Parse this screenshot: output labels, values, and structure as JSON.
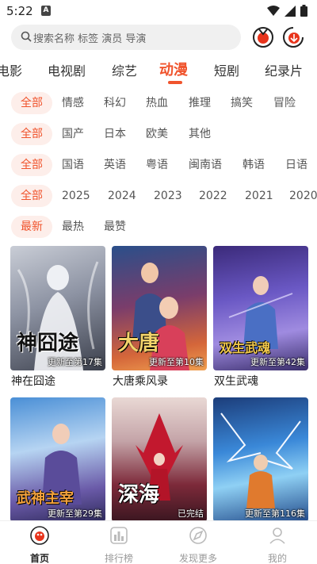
{
  "status_bar": {
    "time": "5:22",
    "app_badge": "A"
  },
  "search": {
    "placeholder": "搜索名称 标签 演员 导演"
  },
  "category_tabs": [
    {
      "label": "电影"
    },
    {
      "label": "电视剧"
    },
    {
      "label": "综艺"
    },
    {
      "label": "动漫",
      "active": true
    },
    {
      "label": "短剧"
    },
    {
      "label": "纪录片"
    }
  ],
  "filters": {
    "genre": [
      "全部",
      "情感",
      "科幻",
      "热血",
      "推理",
      "搞笑",
      "冒险"
    ],
    "region": [
      "全部",
      "国产",
      "日本",
      "欧美",
      "其他"
    ],
    "language": [
      "全部",
      "国语",
      "英语",
      "粤语",
      "闽南语",
      "韩语",
      "日语"
    ],
    "year": [
      "全部",
      "2025",
      "2024",
      "2023",
      "2022",
      "2021",
      "2020"
    ],
    "sort": [
      "最新",
      "最热",
      "最赞"
    ]
  },
  "items": [
    {
      "title": "神在囧途",
      "status": "更新至第17集",
      "poster_text": "神囧途"
    },
    {
      "title": "大唐乘风录",
      "status": "更新至第10集",
      "poster_text": "大唐"
    },
    {
      "title": "双生武魂",
      "status": "更新至第42集",
      "poster_text": "双生武魂"
    },
    {
      "title": "",
      "status": "更新至第29集",
      "poster_text": "武神主宰"
    },
    {
      "title": "",
      "status": "已完结",
      "poster_text": "深海"
    },
    {
      "title": "",
      "status": "更新至第116集",
      "poster_text": ""
    }
  ],
  "bottom_nav": [
    {
      "label": "首页",
      "active": true
    },
    {
      "label": "排行榜"
    },
    {
      "label": "发现更多"
    },
    {
      "label": "我的"
    }
  ],
  "colors": {
    "accent": "#f0542d",
    "chip_bg": "#fdeeea"
  }
}
